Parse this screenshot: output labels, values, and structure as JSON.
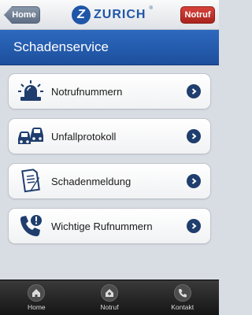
{
  "topbar": {
    "home_label": "Home",
    "brand_name": "ZURICH",
    "brand_reg": "®",
    "brand_logo_letter": "Z",
    "notruf_label": "Notruf"
  },
  "title": "Schadenservice",
  "items": [
    {
      "label": "Notrufnummern",
      "icon": "siren-icon"
    },
    {
      "label": "Unfallprotokoll",
      "icon": "car-accident-icon"
    },
    {
      "label": "Schadenmeldung",
      "icon": "document-pen-icon"
    },
    {
      "label": "Wichtige Rufnummern",
      "icon": "phone-alert-icon"
    }
  ],
  "tabs": [
    {
      "label": "Home",
      "icon": "house-icon"
    },
    {
      "label": "Notruf",
      "icon": "emergency-house-icon"
    },
    {
      "label": "Kontakt",
      "icon": "phone-icon"
    }
  ],
  "colors": {
    "brand_blue": "#1f56a8",
    "title_bar": "#2d69bf",
    "notruf_red": "#c0312a",
    "chevron": "#1f3e6e"
  }
}
